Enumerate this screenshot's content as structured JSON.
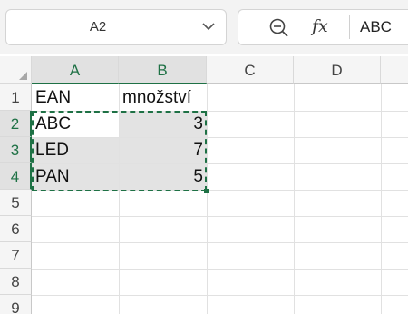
{
  "name_box": {
    "value": "A2"
  },
  "formula_bar": {
    "value": "ABC"
  },
  "icons": {
    "zoom": "zoom-out-icon",
    "function": "fx-icon",
    "dropdown": "chevron-down-icon",
    "select_all": "select-all-triangle-icon"
  },
  "colors": {
    "accent": "#1e7145",
    "selected_range": "#e3e3e3"
  },
  "columns": [
    "A",
    "B",
    "C",
    "D"
  ],
  "rows": [
    "1",
    "2",
    "3",
    "4",
    "5",
    "6",
    "7",
    "8",
    "9"
  ],
  "cells": {
    "A1": "EAN",
    "B1": "množství",
    "A2": "ABC",
    "B2": "3",
    "A3": "LED",
    "B3": "7",
    "A4": "PAN",
    "B4": "5"
  },
  "selection": {
    "active_cell": "A2",
    "range": "A2:B4"
  }
}
